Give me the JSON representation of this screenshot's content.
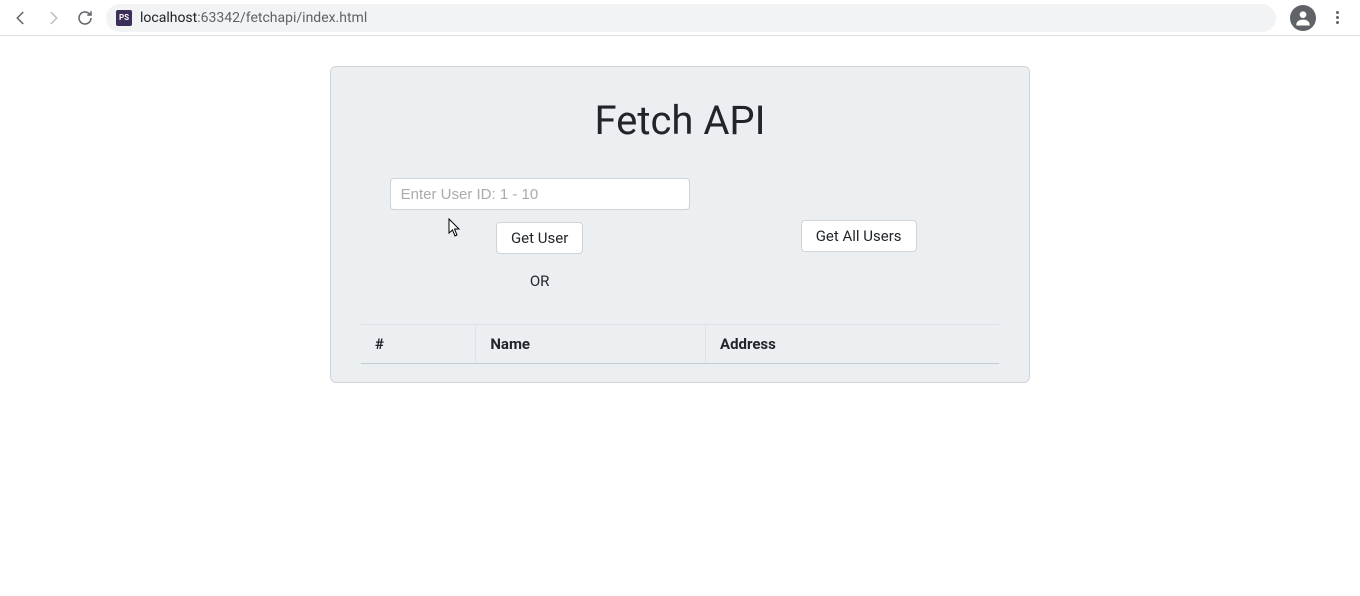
{
  "browser": {
    "url_host": "localhost",
    "url_port_path": ":63342/fetchapi/index.html",
    "favicon_text": "PS"
  },
  "page": {
    "title": "Fetch API",
    "input_placeholder": "Enter User ID: 1 - 10",
    "get_user_label": "Get User",
    "or_label": "OR",
    "get_all_label": "Get All Users",
    "table": {
      "col_id": "#",
      "col_name": "Name",
      "col_address": "Address"
    }
  }
}
